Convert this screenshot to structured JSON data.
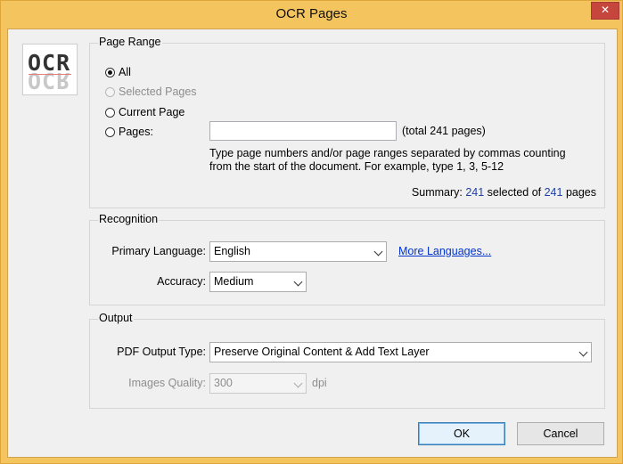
{
  "window": {
    "title": "OCR Pages",
    "close_symbol": "✕"
  },
  "logo": {
    "text": "OCR"
  },
  "page_range": {
    "legend": "Page Range",
    "options": [
      {
        "label": "All",
        "checked": true,
        "enabled": true
      },
      {
        "label": "Selected Pages",
        "checked": false,
        "enabled": false
      },
      {
        "label": "Current Page",
        "checked": false,
        "enabled": true
      },
      {
        "label": "Pages:",
        "checked": false,
        "enabled": true
      }
    ],
    "pages_value": "",
    "total_text": "(total 241 pages)",
    "help_line1": "Type page numbers and/or page ranges separated by commas counting",
    "help_line2": "from the start of the document. For example, type 1, 3, 5-12",
    "summary_prefix": "Summary: ",
    "summary_selected": "241",
    "summary_middle": " selected of ",
    "summary_total": "241",
    "summary_suffix": " pages"
  },
  "recognition": {
    "legend": "Recognition",
    "primary_language_label": "Primary Language:",
    "primary_language_value": "English",
    "more_languages_link": "More Languages...",
    "accuracy_label": "Accuracy:",
    "accuracy_value": "Medium"
  },
  "output": {
    "legend": "Output",
    "pdf_output_type_label": "PDF Output Type:",
    "pdf_output_type_value": "Preserve Original Content & Add Text Layer",
    "images_quality_label": "Images Quality:",
    "images_quality_value": "300",
    "images_quality_unit": "dpi"
  },
  "buttons": {
    "ok": "OK",
    "cancel": "Cancel"
  },
  "colors": {
    "title_bar": "#F4C45F",
    "link": "#0033CC",
    "close_button": "#C6453C"
  }
}
